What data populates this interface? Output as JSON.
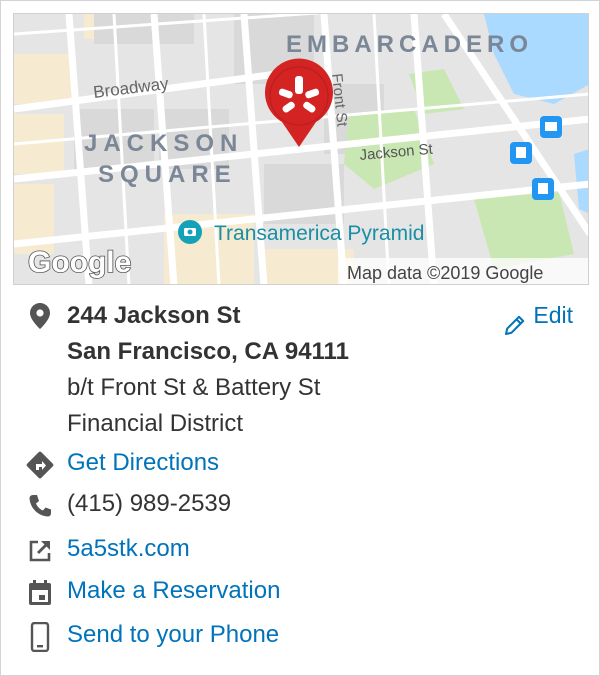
{
  "map": {
    "neighborhood_1": "EMBARCADERO",
    "neighborhood_2_line1": "JACKSON",
    "neighborhood_2_line2": "SQUARE",
    "street_broadway": "Broadway",
    "street_front": "Front St",
    "street_jackson": "Jackson St",
    "poi": "Transamerica Pyramid",
    "logo": "Google",
    "attribution": "Map data ©2019 Google"
  },
  "address": {
    "line1": "244 Jackson St",
    "line2": "San Francisco, CA 94111",
    "cross_streets": "b/t Front St & Battery St",
    "district": "Financial District",
    "edit_label": "Edit"
  },
  "actions": {
    "directions": "Get Directions",
    "phone": "(415) 989-2539",
    "website": "5a5stk.com",
    "reservation": "Make a Reservation",
    "send_phone": "Send to your Phone"
  },
  "colors": {
    "link": "#0073bb",
    "text": "#333333",
    "icon": "#555555",
    "pin": "#d32323"
  },
  "icons": {
    "address": "map-pin-icon",
    "edit": "pencil-icon",
    "directions": "directions-icon",
    "phone": "phone-icon",
    "website": "external-link-icon",
    "reservation": "calendar-icon",
    "send_phone": "mobile-phone-icon"
  }
}
